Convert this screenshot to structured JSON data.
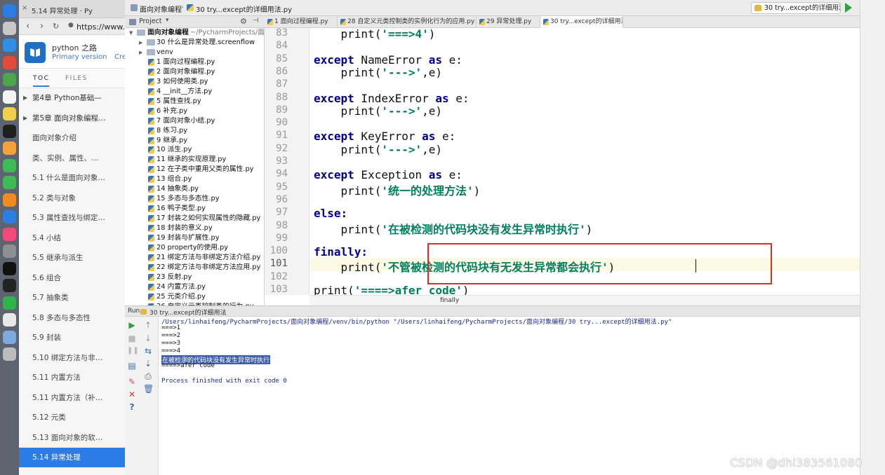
{
  "colors": {
    "keyword": "#00008b",
    "string": "#007f5f",
    "annotation_box": "#d93025",
    "toc_active": "#2d7be5",
    "run_green": "#2ea043",
    "console_selection": "#3d5fa8"
  },
  "dock": {
    "icons": [
      "finder-icon",
      "launchpad-icon",
      "safari-icon",
      "chrome-icon",
      "maps-icon",
      "calendar-icon",
      "notes-icon",
      "pycharm-icon",
      "photos-icon",
      "messages-icon",
      "facetime-icon",
      "pages-icon",
      "appstore-icon",
      "music-icon",
      "system-preferences-icon",
      "qq-icon",
      "terminal-icon",
      "iqiyi-icon",
      "document-icon",
      "folder-icon",
      "trash-icon"
    ]
  },
  "browser": {
    "tab_title": "5.14 异常处理 · Py",
    "url": "https://www.gi",
    "docs": {
      "title": "python 之路",
      "version_link": "Primary version",
      "create_link": "Cre",
      "tabs": [
        "TOC",
        "FILES"
      ],
      "toc": [
        {
          "label": "第4章 Python基础—",
          "chapter": true,
          "active": false
        },
        {
          "label": "第5章 面向对象编程…",
          "chapter": true,
          "active": false
        },
        {
          "label": "面向对象介绍",
          "chapter": false,
          "active": false
        },
        {
          "label": "类、实例、属性、…",
          "chapter": false,
          "active": false
        },
        {
          "label": "5.1 什么是面向对象…",
          "chapter": false,
          "active": false
        },
        {
          "label": "5.2 类与对象",
          "chapter": false,
          "active": false
        },
        {
          "label": "5.3 属性查找与绑定…",
          "chapter": false,
          "active": false
        },
        {
          "label": "5.4 小结",
          "chapter": false,
          "active": false
        },
        {
          "label": "5.5 继承与派生",
          "chapter": false,
          "active": false
        },
        {
          "label": "5.6 组合",
          "chapter": false,
          "active": false
        },
        {
          "label": "5.7 抽象类",
          "chapter": false,
          "active": false
        },
        {
          "label": "5.8 多态与多态性",
          "chapter": false,
          "active": false
        },
        {
          "label": "5.9 封装",
          "chapter": false,
          "active": false
        },
        {
          "label": "5.10 绑定方法与非…",
          "chapter": false,
          "active": false
        },
        {
          "label": "5.11 内置方法",
          "chapter": false,
          "active": false
        },
        {
          "label": "5.11 内置方法（补…",
          "chapter": false,
          "active": false
        },
        {
          "label": "5.12 元类",
          "chapter": false,
          "active": false
        },
        {
          "label": "5.13 面向对象的软…",
          "chapter": false,
          "active": false
        },
        {
          "label": "5.14 异常处理",
          "chapter": false,
          "active": true
        }
      ]
    }
  },
  "ide": {
    "breadcrumbs": [
      "面向对象编程",
      "30 try...except的详细用法.py"
    ],
    "run_config": "30 try...except的详细用法",
    "project": {
      "header": "Project",
      "root": "面向对象编程",
      "root_path": "~/PycharmProjects/面向",
      "items": [
        {
          "label": "30 什么是异常处理.screenflow",
          "kind": "folder",
          "indent": 1
        },
        {
          "label": "venv",
          "kind": "folder",
          "indent": 1
        },
        {
          "label": "1 面向过程编程.py",
          "kind": "py",
          "indent": 2
        },
        {
          "label": "2 面向对象编程.py",
          "kind": "py",
          "indent": 2
        },
        {
          "label": "3 如何使用类.py",
          "kind": "py",
          "indent": 2
        },
        {
          "label": "4 __init__方法.py",
          "kind": "py",
          "indent": 2
        },
        {
          "label": "5 属性查找.py",
          "kind": "py",
          "indent": 2
        },
        {
          "label": "6 补充.py",
          "kind": "py",
          "indent": 2
        },
        {
          "label": "7 面向对象小结.py",
          "kind": "py",
          "indent": 2
        },
        {
          "label": "8 练习.py",
          "kind": "py",
          "indent": 2
        },
        {
          "label": "9 继承.py",
          "kind": "py",
          "indent": 2
        },
        {
          "label": "10 派生.py",
          "kind": "py",
          "indent": 2
        },
        {
          "label": "11 继承的实现原理.py",
          "kind": "py",
          "indent": 2
        },
        {
          "label": "12 在子类中重用父类的属性.py",
          "kind": "py",
          "indent": 2
        },
        {
          "label": "13 组合.py",
          "kind": "py",
          "indent": 2
        },
        {
          "label": "14 抽象类.py",
          "kind": "py",
          "indent": 2
        },
        {
          "label": "15 多态与多态性.py",
          "kind": "py",
          "indent": 2
        },
        {
          "label": "16 鸭子类型.py",
          "kind": "py",
          "indent": 2
        },
        {
          "label": "17 封装之如何实现属性的隐藏.py",
          "kind": "py",
          "indent": 2
        },
        {
          "label": "18 封装的意义.py",
          "kind": "py",
          "indent": 2
        },
        {
          "label": "19 封装与扩展性.py",
          "kind": "py",
          "indent": 2
        },
        {
          "label": "20 property的使用.py",
          "kind": "py",
          "indent": 2
        },
        {
          "label": "21 绑定方法与非绑定方法介绍.py",
          "kind": "py",
          "indent": 2
        },
        {
          "label": "22 绑定方法与非绑定方法应用.py",
          "kind": "py",
          "indent": 2
        },
        {
          "label": "23 反射.py",
          "kind": "py",
          "indent": 2
        },
        {
          "label": "24 内置方法.py",
          "kind": "py",
          "indent": 2
        },
        {
          "label": "25 元类介绍.py",
          "kind": "py",
          "indent": 2
        },
        {
          "label": "26 自定义元类控制类的行为.py",
          "kind": "py",
          "indent": 2
        }
      ]
    },
    "editor_tabs": [
      {
        "label": "1 面向过程编程.py",
        "active": false
      },
      {
        "label": "28 自定义元类控制类的实例化行为的应用.py",
        "active": false
      },
      {
        "label": "29 异常处理.py",
        "active": false
      },
      {
        "label": "30 try...except的详细用法.py",
        "active": true
      }
    ],
    "code": [
      {
        "n": "83",
        "indent": "    ",
        "parts": [
          {
            "t": "print(",
            "c": "ident"
          },
          {
            "t": "'===>4'",
            "c": "str"
          },
          {
            "t": ")",
            "c": "ident"
          }
        ]
      },
      {
        "n": "84",
        "indent": "",
        "parts": []
      },
      {
        "n": "85",
        "indent": "",
        "parts": [
          {
            "t": "except",
            "c": "kw"
          },
          {
            "t": " NameError ",
            "c": "ident"
          },
          {
            "t": "as",
            "c": "kw"
          },
          {
            "t": " e:",
            "c": "ident"
          }
        ]
      },
      {
        "n": "86",
        "indent": "    ",
        "parts": [
          {
            "t": "print(",
            "c": "ident"
          },
          {
            "t": "'--->'",
            "c": "str"
          },
          {
            "t": ",e)",
            "c": "ident"
          }
        ]
      },
      {
        "n": "87",
        "indent": "",
        "parts": []
      },
      {
        "n": "88",
        "indent": "",
        "parts": [
          {
            "t": "except",
            "c": "kw"
          },
          {
            "t": " IndexError ",
            "c": "ident"
          },
          {
            "t": "as",
            "c": "kw"
          },
          {
            "t": " e:",
            "c": "ident"
          }
        ]
      },
      {
        "n": "89",
        "indent": "    ",
        "parts": [
          {
            "t": "print(",
            "c": "ident"
          },
          {
            "t": "'--->'",
            "c": "str"
          },
          {
            "t": ",e)",
            "c": "ident"
          }
        ]
      },
      {
        "n": "90",
        "indent": "",
        "parts": []
      },
      {
        "n": "91",
        "indent": "",
        "parts": [
          {
            "t": "except",
            "c": "kw"
          },
          {
            "t": " KeyError ",
            "c": "ident"
          },
          {
            "t": "as",
            "c": "kw"
          },
          {
            "t": " e:",
            "c": "ident"
          }
        ]
      },
      {
        "n": "92",
        "indent": "    ",
        "parts": [
          {
            "t": "print(",
            "c": "ident"
          },
          {
            "t": "'--->'",
            "c": "str"
          },
          {
            "t": ",e)",
            "c": "ident"
          }
        ]
      },
      {
        "n": "93",
        "indent": "",
        "parts": []
      },
      {
        "n": "94",
        "indent": "",
        "parts": [
          {
            "t": "except",
            "c": "kw"
          },
          {
            "t": " Exception ",
            "c": "ident"
          },
          {
            "t": "as",
            "c": "kw"
          },
          {
            "t": " e:",
            "c": "ident"
          }
        ]
      },
      {
        "n": "95",
        "indent": "    ",
        "parts": [
          {
            "t": "print(",
            "c": "ident"
          },
          {
            "t": "'统一的处理方法'",
            "c": "str"
          },
          {
            "t": ")",
            "c": "ident"
          }
        ]
      },
      {
        "n": "96",
        "indent": "",
        "parts": []
      },
      {
        "n": "97",
        "indent": "",
        "parts": [
          {
            "t": "else:",
            "c": "kw"
          }
        ]
      },
      {
        "n": "98",
        "indent": "    ",
        "parts": [
          {
            "t": "print(",
            "c": "ident"
          },
          {
            "t": "'在被检测的代码块没有发生异常时执行'",
            "c": "str"
          },
          {
            "t": ")",
            "c": "ident"
          }
        ]
      },
      {
        "n": "99",
        "indent": "",
        "parts": []
      },
      {
        "n": "100",
        "indent": "",
        "parts": [
          {
            "t": "finally:",
            "c": "kw"
          }
        ]
      },
      {
        "n": "101",
        "indent": "    ",
        "parts": [
          {
            "t": "print(",
            "c": "ident"
          },
          {
            "t": "'不管被检测的代码块有无发生异常都会执行'",
            "c": "str"
          },
          {
            "t": ")",
            "c": "ident"
          }
        ],
        "current": true
      },
      {
        "n": "102",
        "indent": "",
        "parts": []
      },
      {
        "n": "103",
        "indent": "",
        "parts": [
          {
            "t": "print(",
            "c": "ident"
          },
          {
            "t": "'====>afer code'",
            "c": "str"
          },
          {
            "t": ")",
            "c": "ident"
          }
        ]
      }
    ],
    "code_breadcrumb": "finally",
    "run": {
      "tab_label": "Run",
      "run_name": "30 try...except的详细用法",
      "console": [
        {
          "text": "/Users/linhaifeng/PycharmProjects/面向对象编程/venv/bin/python \"/Users/linhaifeng/PycharmProjects/面向对象编程/30 try...except的详细用法.py\"",
          "style": "cmd"
        },
        {
          "text": "===>1",
          "style": "out"
        },
        {
          "text": "===>2",
          "style": "out"
        },
        {
          "text": "===>3",
          "style": "out"
        },
        {
          "text": "===>4",
          "style": "out"
        },
        {
          "text": "在被检测的代码块没有发生异常时执行",
          "style": "sel"
        },
        {
          "text": "====>afer code",
          "style": "out"
        },
        {
          "text": "",
          "style": "out"
        },
        {
          "text": "Process finished with exit code 0",
          "style": "proc"
        }
      ]
    }
  },
  "watermark": "CSDN @dhl383561080"
}
